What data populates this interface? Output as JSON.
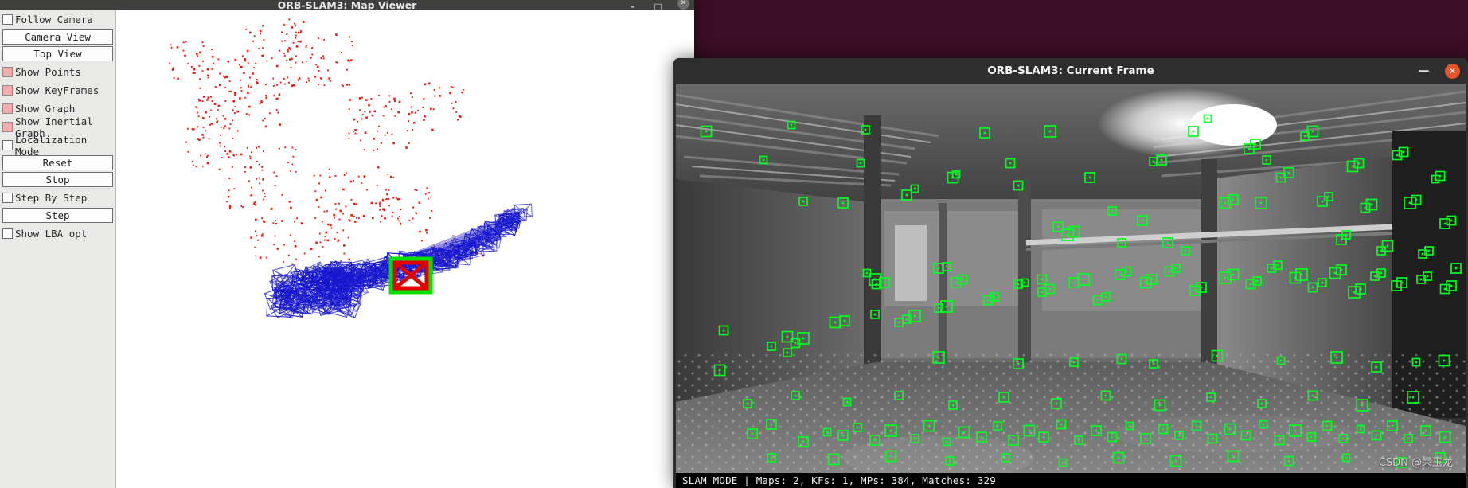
{
  "desktop": {
    "background_color": "#3c0d26"
  },
  "map_window": {
    "title": "ORB-SLAM3: Map Viewer",
    "window_controls": {
      "minimize": "–",
      "maximize": "□",
      "close": "✕"
    },
    "panel": {
      "items": [
        {
          "type": "checkbox",
          "label": "Follow Camera",
          "checked": false,
          "style": "empty"
        },
        {
          "type": "button",
          "label": "Camera View"
        },
        {
          "type": "button",
          "label": "Top View"
        },
        {
          "type": "checkbox",
          "label": "Show Points",
          "checked": true,
          "style": "pink"
        },
        {
          "type": "checkbox",
          "label": "Show KeyFrames",
          "checked": true,
          "style": "pink"
        },
        {
          "type": "checkbox",
          "label": "Show Graph",
          "checked": true,
          "style": "pink"
        },
        {
          "type": "checkbox",
          "label": "Show Inertial Graph",
          "checked": true,
          "style": "pink"
        },
        {
          "type": "checkbox",
          "label": "Localization Mode",
          "checked": false,
          "style": "empty"
        },
        {
          "type": "button",
          "label": "Reset"
        },
        {
          "type": "button",
          "label": "Stop"
        },
        {
          "type": "checkbox",
          "label": "Step By Step",
          "checked": false,
          "style": "empty"
        },
        {
          "type": "button",
          "label": "Step"
        },
        {
          "type": "checkbox",
          "label": "Show LBA opt",
          "checked": false,
          "style": "empty"
        }
      ]
    },
    "canvas": {
      "background_color": "#ffffff",
      "map_point_color": "#e81c10",
      "keyframe_color": "#1818cf",
      "current_camera_color": "#00e000",
      "current_camera_cross_color": "#e00000"
    }
  },
  "frame_window": {
    "title": "ORB-SLAM3: Current Frame",
    "window_controls": {
      "minimize": "—",
      "close": "✕",
      "close_color": "#e8532a"
    },
    "feature_color": "#00ff1e",
    "status": "SLAM MODE |  Maps: 2, KFs: 1, MPs: 384, Matches: 329",
    "status_values": {
      "mode": "SLAM MODE",
      "maps": 2,
      "kfs": 1,
      "mps": 384,
      "matches": 329
    },
    "watermark": "CSDN @呆玉龙"
  }
}
